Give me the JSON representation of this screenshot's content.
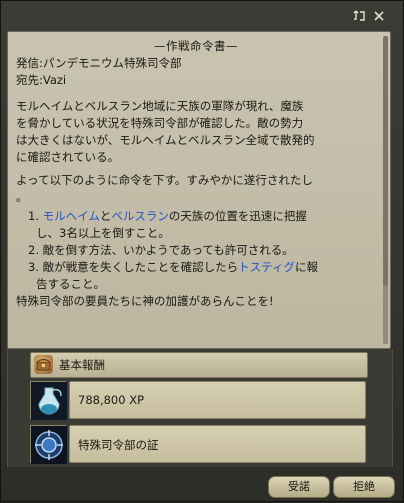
{
  "window": {
    "pin_icon": "pin-icon",
    "close_icon": "close-icon"
  },
  "document": {
    "title": "—作戦命令書—",
    "sender": "発信:パンデモニウム特殊司令部",
    "recipient": "宛先:Vazi",
    "paragraph1": [
      "モルヘイムとベルスラン地域に天族の軍隊が現れ、魔族",
      "を脅かしている状況を特殊司令部が確認した。敵の勢力",
      "は大きくはないが、モルヘイムとベルスラン全域で散発的",
      "に確認されている。"
    ],
    "paragraph2": [
      "よって以下のように命令を下す。すみやかに遂行されたし",
      "。"
    ],
    "item1": {
      "num": "1.",
      "loc1": "モルヘイム",
      "and": "と",
      "loc2": "ベルスラン",
      "rest": "の天族の位置を迅速に把握",
      "line2": "し、3名以上を倒すこと。"
    },
    "item2": {
      "num": "2.",
      "text": "敵を倒す方法、いかようであっても許可される。"
    },
    "item3": {
      "num": "3.",
      "pre": "敵が戦意を失くしたことを確認したら",
      "npc": "トスティグ",
      "post": "に報",
      "line2": "告すること。"
    },
    "closing": "特殊司令部の要員たちに神の加護があらんことを!"
  },
  "rewards": {
    "header": "基本報酬",
    "header_icon": "reward-chest-icon",
    "items": [
      {
        "icon": "xp-vial-icon",
        "label": "788,800  XP"
      },
      {
        "icon": "blue-emblem-icon",
        "label": "特殊司令部の証"
      }
    ]
  },
  "buttons": {
    "accept": "受諾",
    "reject": "拒絶"
  }
}
